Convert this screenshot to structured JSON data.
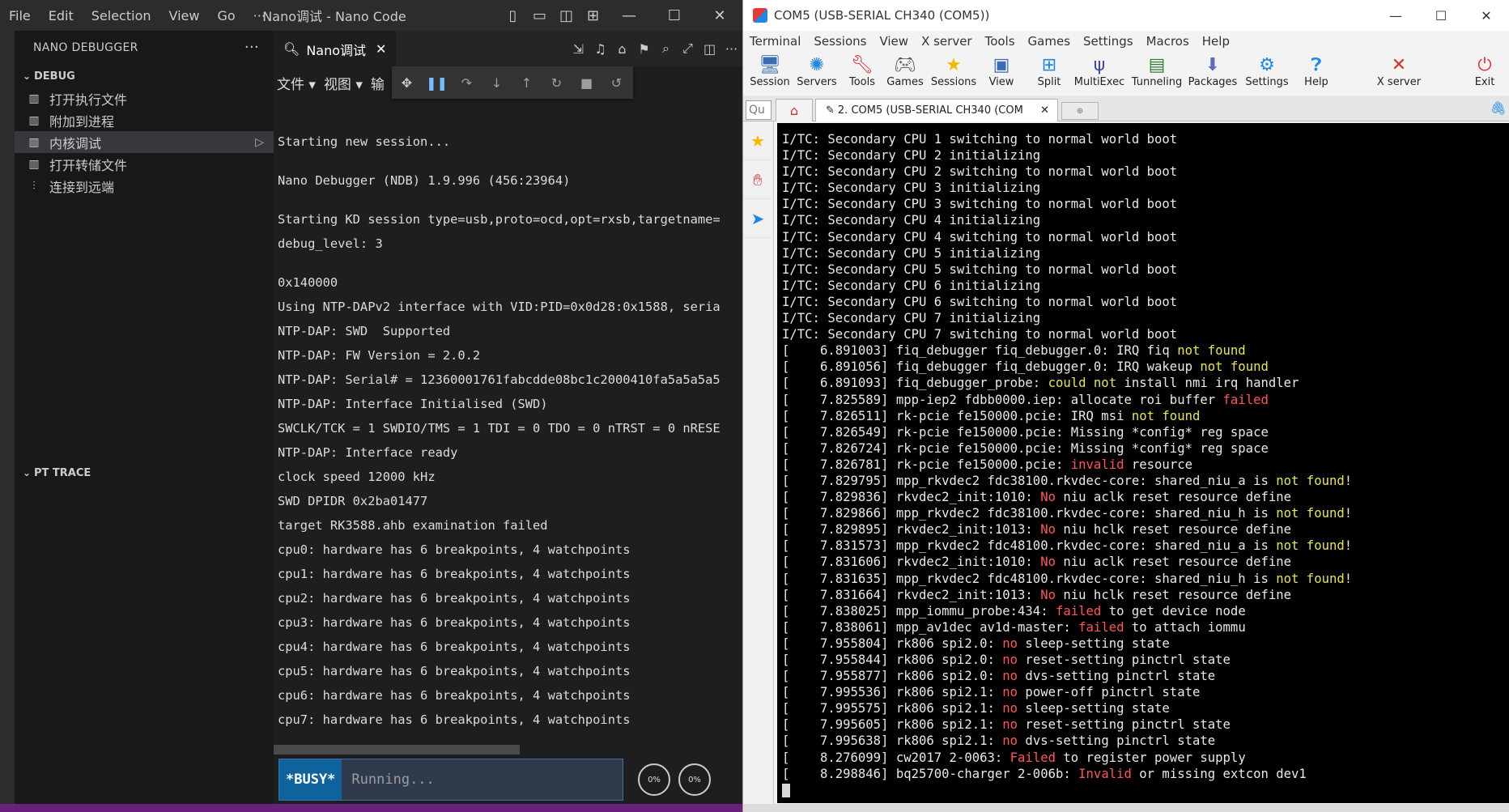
{
  "nano": {
    "menu": [
      "File",
      "Edit",
      "Selection",
      "View",
      "Go",
      "···"
    ],
    "title": "Nano调试 - Nano Code",
    "sidebar": {
      "header": "NANO DEBUGGER",
      "more": "···",
      "debug_section": "DEBUG",
      "items": [
        {
          "label": "打开执行文件",
          "icon": "file-icon"
        },
        {
          "label": "附加到进程",
          "icon": "attach-icon"
        },
        {
          "label": "内核调试",
          "icon": "kernel-icon",
          "active": true
        },
        {
          "label": "打开转储文件",
          "icon": "dump-icon"
        },
        {
          "label": "连接到远端",
          "icon": "remote-icon"
        }
      ],
      "pt_trace_section": "PT TRACE"
    },
    "tab": {
      "label": "Nano调试"
    },
    "editor_menu": [
      "文件",
      "视图",
      "输"
    ],
    "console_lines": [
      "",
      "Starting new session...",
      "",
      "Nano Debugger (NDB) 1.9.996 (456:23964)",
      "",
      "Starting KD session type=usb,proto=ocd,opt=rxsb,targetname=",
      "debug_level: 3",
      "",
      "0x140000",
      "Using NTP-DAPv2 interface with VID:PID=0x0d28:0x1588, seria",
      "NTP-DAP: SWD  Supported",
      "NTP-DAP: FW Version = 2.0.2",
      "NTP-DAP: Serial# = 12360001761fabcdde08bc1c2000410fa5a5a5a5",
      "NTP-DAP: Interface Initialised (SWD)",
      "SWCLK/TCK = 1 SWDIO/TMS = 1 TDI = 0 TDO = 0 nTRST = 0 nRESE",
      "NTP-DAP: Interface ready",
      "clock speed 12000 kHz",
      "SWD DPIDR 0x2ba01477",
      "target RK3588.ahb examination failed",
      "cpu0: hardware has 6 breakpoints, 4 watchpoints",
      "cpu1: hardware has 6 breakpoints, 4 watchpoints",
      "cpu2: hardware has 6 breakpoints, 4 watchpoints",
      "cpu3: hardware has 6 breakpoints, 4 watchpoints",
      "cpu4: hardware has 6 breakpoints, 4 watchpoints",
      "cpu5: hardware has 6 breakpoints, 4 watchpoints",
      "cpu6: hardware has 6 breakpoints, 4 watchpoints",
      "cpu7: hardware has 6 breakpoints, 4 watchpoints"
    ],
    "busy_label": "*BUSY*",
    "busy_text": "Running...",
    "pct1": "0%",
    "pct2": "0%"
  },
  "moba": {
    "title": "COM5  (USB-SERIAL CH340 (COM5))",
    "menu": [
      "Terminal",
      "Sessions",
      "View",
      "X server",
      "Tools",
      "Games",
      "Settings",
      "Macros",
      "Help"
    ],
    "toolbar": [
      {
        "label": "Session",
        "icon": "session-icon"
      },
      {
        "label": "Servers",
        "icon": "servers-icon"
      },
      {
        "label": "Tools",
        "icon": "tools-icon"
      },
      {
        "label": "Games",
        "icon": "games-icon"
      },
      {
        "label": "Sessions",
        "icon": "sessions-star-icon"
      },
      {
        "label": "View",
        "icon": "view-icon"
      },
      {
        "label": "Split",
        "icon": "split-icon"
      },
      {
        "label": "MultiExec",
        "icon": "multiexec-icon"
      },
      {
        "label": "Tunneling",
        "icon": "tunneling-icon"
      },
      {
        "label": "Packages",
        "icon": "packages-icon"
      },
      {
        "label": "Settings",
        "icon": "settings-icon"
      },
      {
        "label": "Help",
        "icon": "help-icon"
      },
      {
        "label": "X server",
        "icon": "xserver-icon"
      },
      {
        "label": "Exit",
        "icon": "exit-icon"
      }
    ],
    "quick_connect": "Qu",
    "session_tab": "2. COM5  (USB-SERIAL CH340 (COM",
    "terminal_lines": [
      [
        {
          "t": "I/TC: Secondary CPU 1 switching to normal world boot"
        }
      ],
      [
        {
          "t": "I/TC: Secondary CPU 2 initializing"
        }
      ],
      [
        {
          "t": "I/TC: Secondary CPU 2 switching to normal world boot"
        }
      ],
      [
        {
          "t": "I/TC: Secondary CPU 3 initializing"
        }
      ],
      [
        {
          "t": "I/TC: Secondary CPU 3 switching to normal world boot"
        }
      ],
      [
        {
          "t": "I/TC: Secondary CPU 4 initializing"
        }
      ],
      [
        {
          "t": "I/TC: Secondary CPU 4 switching to normal world boot"
        }
      ],
      [
        {
          "t": "I/TC: Secondary CPU 5 initializing"
        }
      ],
      [
        {
          "t": "I/TC: Secondary CPU 5 switching to normal world boot"
        }
      ],
      [
        {
          "t": "I/TC: Secondary CPU 6 initializing"
        }
      ],
      [
        {
          "t": "I/TC: Secondary CPU 6 switching to normal world boot"
        }
      ],
      [
        {
          "t": "I/TC: Secondary CPU 7 initializing"
        }
      ],
      [
        {
          "t": "I/TC: Secondary CPU 7 switching to normal world boot"
        }
      ],
      [
        {
          "t": "[    6.891003] fiq_debugger fiq_debugger.0: IRQ fiq "
        },
        {
          "t": "not found",
          "c": "y"
        }
      ],
      [
        {
          "t": "[    6.891056] fiq_debugger fiq_debugger.0: IRQ wakeup "
        },
        {
          "t": "not found",
          "c": "y"
        }
      ],
      [
        {
          "t": "[    6.891093] fiq_debugger_probe: "
        },
        {
          "t": "could not",
          "c": "y"
        },
        {
          "t": " install nmi irq handler"
        }
      ],
      [
        {
          "t": "[    7.825589] mpp-iep2 fdbb0000.iep: allocate roi buffer "
        },
        {
          "t": "failed",
          "c": "r"
        }
      ],
      [
        {
          "t": "[    7.826511] rk-pcie fe150000.pcie: IRQ msi "
        },
        {
          "t": "not found",
          "c": "y"
        }
      ],
      [
        {
          "t": "[    7.826549] rk-pcie fe150000.pcie: Missing *config* reg space"
        }
      ],
      [
        {
          "t": "[    7.826724] rk-pcie fe150000.pcie: Missing *config* reg space"
        }
      ],
      [
        {
          "t": "[    7.826781] rk-pcie fe150000.pcie: "
        },
        {
          "t": "invalid",
          "c": "r"
        },
        {
          "t": " resource"
        }
      ],
      [
        {
          "t": "[    7.829795] mpp_rkvdec2 fdc38100.rkvdec-core: shared_niu_a is "
        },
        {
          "t": "not found",
          "c": "y"
        },
        {
          "t": "!"
        }
      ],
      [
        {
          "t": "[    7.829836] rkvdec2_init:1010: "
        },
        {
          "t": "No",
          "c": "r"
        },
        {
          "t": " niu aclk reset resource define"
        }
      ],
      [
        {
          "t": "[    7.829866] mpp_rkvdec2 fdc38100.rkvdec-core: shared_niu_h is "
        },
        {
          "t": "not found",
          "c": "y"
        },
        {
          "t": "!"
        }
      ],
      [
        {
          "t": "[    7.829895] rkvdec2_init:1013: "
        },
        {
          "t": "No",
          "c": "r"
        },
        {
          "t": " niu hclk reset resource define"
        }
      ],
      [
        {
          "t": "[    7.831573] mpp_rkvdec2 fdc48100.rkvdec-core: shared_niu_a is "
        },
        {
          "t": "not found",
          "c": "y"
        },
        {
          "t": "!"
        }
      ],
      [
        {
          "t": "[    7.831606] rkvdec2_init:1010: "
        },
        {
          "t": "No",
          "c": "r"
        },
        {
          "t": " niu aclk reset resource define"
        }
      ],
      [
        {
          "t": "[    7.831635] mpp_rkvdec2 fdc48100.rkvdec-core: shared_niu_h is "
        },
        {
          "t": "not found",
          "c": "y"
        },
        {
          "t": "!"
        }
      ],
      [
        {
          "t": "[    7.831664] rkvdec2_init:1013: "
        },
        {
          "t": "No",
          "c": "r"
        },
        {
          "t": " niu hclk reset resource define"
        }
      ],
      [
        {
          "t": "[    7.838025] mpp_iommu_probe:434: "
        },
        {
          "t": "failed",
          "c": "r"
        },
        {
          "t": " to get device node"
        }
      ],
      [
        {
          "t": "[    7.838061] mpp_av1dec av1d-master: "
        },
        {
          "t": "failed",
          "c": "r"
        },
        {
          "t": " to attach iommu"
        }
      ],
      [
        {
          "t": "[    7.955804] rk806 spi2.0: "
        },
        {
          "t": "no",
          "c": "r"
        },
        {
          "t": " sleep-setting state"
        }
      ],
      [
        {
          "t": "[    7.955844] rk806 spi2.0: "
        },
        {
          "t": "no",
          "c": "r"
        },
        {
          "t": " reset-setting pinctrl state"
        }
      ],
      [
        {
          "t": "[    7.955877] rk806 spi2.0: "
        },
        {
          "t": "no",
          "c": "r"
        },
        {
          "t": " dvs-setting pinctrl state"
        }
      ],
      [
        {
          "t": "[    7.995536] rk806 spi2.1: "
        },
        {
          "t": "no",
          "c": "r"
        },
        {
          "t": " power-off pinctrl state"
        }
      ],
      [
        {
          "t": "[    7.995575] rk806 spi2.1: "
        },
        {
          "t": "no",
          "c": "r"
        },
        {
          "t": " sleep-setting state"
        }
      ],
      [
        {
          "t": "[    7.995605] rk806 spi2.1: "
        },
        {
          "t": "no",
          "c": "r"
        },
        {
          "t": " reset-setting pinctrl state"
        }
      ],
      [
        {
          "t": "[    7.995638] rk806 spi2.1: "
        },
        {
          "t": "no",
          "c": "r"
        },
        {
          "t": " dvs-setting pinctrl state"
        }
      ],
      [
        {
          "t": "[    8.276099] cw2017 2-0063: "
        },
        {
          "t": "Failed",
          "c": "r"
        },
        {
          "t": " to register power supply"
        }
      ],
      [
        {
          "t": "[    8.298846] bq25700-charger 2-006b: "
        },
        {
          "t": "Invalid",
          "c": "r"
        },
        {
          "t": " or missing extcon dev1"
        }
      ]
    ]
  }
}
